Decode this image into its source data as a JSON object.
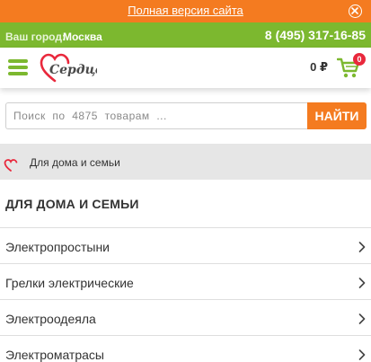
{
  "topbar": {
    "full_version_link": "Полная версия сайта"
  },
  "citybar": {
    "city_label": "Ваш город:",
    "city_value": "Москва",
    "phone": "8 (495) 317-16-85"
  },
  "header": {
    "logo_text": "Сердце",
    "cart_total": "0 ₽",
    "cart_count": "0"
  },
  "search": {
    "placeholder": "Поиск  по  4875  товарам  ...",
    "button_label": "НАЙТИ"
  },
  "breadcrumb": {
    "current": "Для дома и семьи"
  },
  "page": {
    "title": "ДЛЯ ДОМА И СЕМЬИ"
  },
  "categories": [
    {
      "label": "Электропростыни"
    },
    {
      "label": "Грелки электрические"
    },
    {
      "label": "Электроодеяла"
    },
    {
      "label": "Электроматрасы"
    }
  ],
  "colors": {
    "accent_orange": "#f47b20",
    "brand_green": "#7cb82f",
    "heart_red": "#e9283c"
  }
}
